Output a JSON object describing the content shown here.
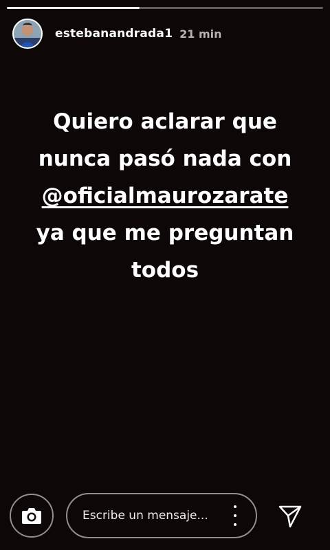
{
  "progress": {
    "fraction": 0.42
  },
  "header": {
    "username": "estebanandrada1",
    "timestamp": "21 min",
    "avatar_icon": "profile-photo-icon"
  },
  "story": {
    "lines": [
      "Quiero aclarar que",
      "nunca pasó nada con",
      "@oficialmaurozarate",
      "ya que me preguntan",
      "todos"
    ]
  },
  "bottom_bar": {
    "camera_icon": "camera-icon",
    "message_placeholder": "Escribe un mensaje...",
    "more_icon": "more-vertical-icon",
    "send_icon": "send-icon"
  },
  "colors": {
    "background": "#0d0707",
    "text": "#ffffff",
    "muted": "#b4b4b4"
  }
}
